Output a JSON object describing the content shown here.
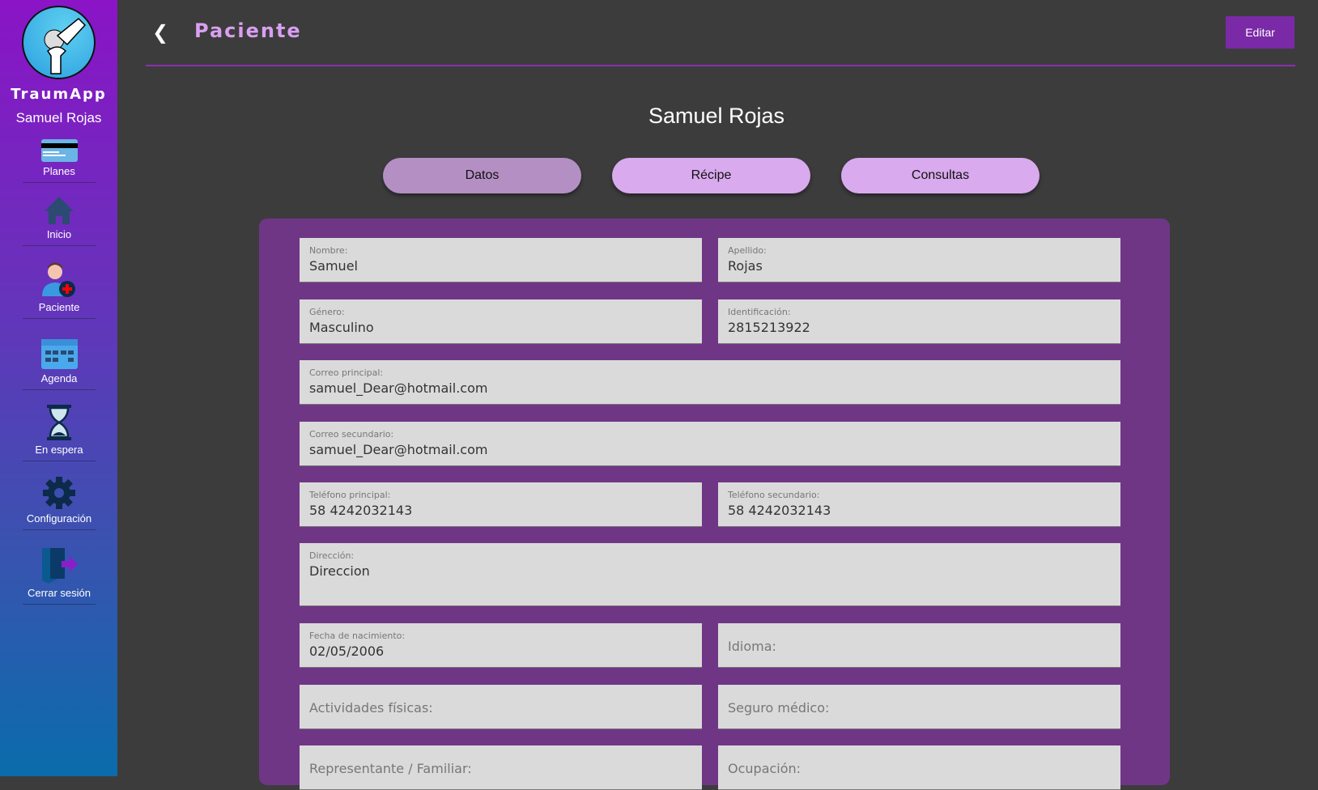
{
  "sidebar": {
    "brand": "TraumApp",
    "user": "Samuel Rojas",
    "items": [
      {
        "label": "Planes",
        "icon": "credit-card-icon"
      },
      {
        "label": "Inicio",
        "icon": "home-icon"
      },
      {
        "label": "Paciente",
        "icon": "add-patient-icon"
      },
      {
        "label": "Agenda",
        "icon": "calendar-icon"
      },
      {
        "label": "En espera",
        "icon": "hourglass-icon"
      },
      {
        "label": "Configuración",
        "icon": "gear-icon"
      },
      {
        "label": "Cerrar sesión",
        "icon": "logout-icon"
      }
    ]
  },
  "header": {
    "title": "Paciente",
    "edit": "Editar"
  },
  "patient": {
    "name": "Samuel Rojas"
  },
  "tabs": [
    "Datos",
    "Récipe",
    "Consultas"
  ],
  "fields": {
    "nombre": {
      "label": "Nombre:",
      "value": "Samuel"
    },
    "apellido": {
      "label": "Apellido:",
      "value": "Rojas"
    },
    "genero": {
      "label": "Género:",
      "value": "Masculino"
    },
    "identificacion": {
      "label": "Identificación:",
      "value": "2815213922"
    },
    "correo1": {
      "label": "Correo principal:",
      "value": "samuel_Dear@hotmail.com"
    },
    "correo2": {
      "label": "Correo secundario:",
      "value": "samuel_Dear@hotmail.com"
    },
    "tel1": {
      "label": "Teléfono principal:",
      "value": "58 4242032143"
    },
    "tel2": {
      "label": "Teléfono secundario:",
      "value": "58 4242032143"
    },
    "direccion": {
      "label": "Dirección:",
      "value": "Direccion"
    },
    "nacimiento": {
      "label": "Fecha de nacimiento:",
      "value": "02/05/2006"
    },
    "idioma": {
      "placeholder": "Idioma:"
    },
    "actividades": {
      "placeholder": "Actividades físicas:"
    },
    "seguro": {
      "placeholder": "Seguro médico:"
    },
    "representante": {
      "placeholder": "Representante / Familiar:"
    },
    "ocupacion": {
      "placeholder": "Ocupación:"
    }
  },
  "colors": {
    "accent": "#7a2aa6",
    "card": "#6f3686",
    "background": "#3c3c3c"
  }
}
